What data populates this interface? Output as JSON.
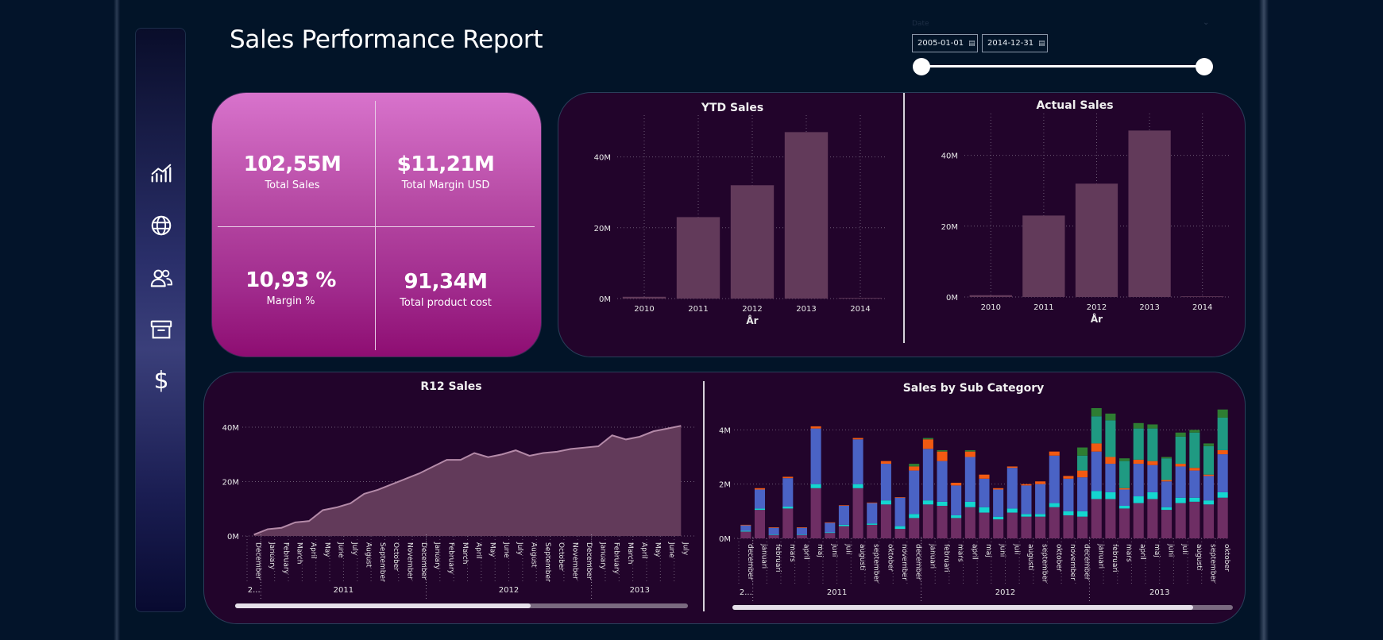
{
  "report": {
    "title": "Sales Performance Report"
  },
  "nav": {
    "items": [
      {
        "name": "nav-performance",
        "icon": "line-chart-icon"
      },
      {
        "name": "nav-geography",
        "icon": "globe-icon"
      },
      {
        "name": "nav-customers",
        "icon": "people-icon"
      },
      {
        "name": "nav-products",
        "icon": "archive-box-icon"
      },
      {
        "name": "nav-finance",
        "icon": "dollar-icon",
        "glyph": "$"
      }
    ]
  },
  "date_filter": {
    "label": "Date",
    "start": "2005-01-01",
    "end": "2014-12-31"
  },
  "kpis": {
    "total_sales": {
      "value": "102,55M",
      "label": "Total Sales"
    },
    "total_margin": {
      "value": "$11,21M",
      "label": "Total Margin USD"
    },
    "margin_pct": {
      "value": "10,93 %",
      "label": "Margin %"
    },
    "product_cost": {
      "value": "91,34M",
      "label": "Total product cost"
    }
  },
  "colors": {
    "bar": "#623a5a",
    "area": "#623a5a",
    "area_line": "#b48aa8",
    "panel_bg": "#22042b",
    "sub_purple": "#6e2e64",
    "sub_blue": "#4a63c5",
    "sub_cyan": "#14d6d0",
    "sub_teal": "#1f9a82",
    "sub_orange": "#f25a12",
    "sub_green": "#2e7d32"
  },
  "chart_data": [
    {
      "id": "ytd",
      "type": "bar",
      "title": "YTD Sales",
      "xlabel": "År",
      "ylabel": "",
      "categories": [
        "2010",
        "2011",
        "2012",
        "2013",
        "2014"
      ],
      "values": [
        0.5,
        23,
        32,
        47,
        0
      ],
      "yticks": [
        "0M",
        "20M",
        "40M"
      ],
      "ylim": [
        0,
        50
      ],
      "grid": true
    },
    {
      "id": "actual",
      "type": "bar",
      "title": "Actual Sales",
      "xlabel": "År",
      "ylabel": "",
      "categories": [
        "2010",
        "2011",
        "2012",
        "2013",
        "2014"
      ],
      "values": [
        0.5,
        23,
        32,
        47,
        0
      ],
      "yticks": [
        "0M",
        "20M",
        "40M"
      ],
      "ylim": [
        0,
        50
      ],
      "grid": true
    },
    {
      "id": "r12",
      "type": "area",
      "title": "R12 Sales",
      "months": [
        "December",
        "January",
        "February",
        "March",
        "April",
        "May",
        "June",
        "July",
        "August",
        "September",
        "October",
        "November",
        "December",
        "January",
        "February",
        "March",
        "April",
        "May",
        "June",
        "July",
        "August",
        "September",
        "October",
        "November",
        "December",
        "January",
        "February",
        "March",
        "April",
        "May",
        "June",
        "July"
      ],
      "values": [
        0.5,
        2.5,
        3,
        5,
        5.5,
        9.5,
        10.5,
        12,
        15.5,
        17,
        19,
        21,
        23,
        25.5,
        28,
        28,
        30.5,
        29,
        30,
        31.5,
        29.5,
        30.5,
        31,
        32,
        32.5,
        33,
        37,
        35.5,
        36.5,
        38.5,
        39.5,
        40.5
      ],
      "years": [
        "2...",
        "2011",
        "2012",
        "2013"
      ],
      "year_month_counts": [
        1,
        12,
        12,
        7
      ],
      "yticks": [
        "0M",
        "20M",
        "40M"
      ],
      "ylim": [
        0,
        40
      ],
      "grid": true
    },
    {
      "id": "subcat",
      "type": "bar",
      "title": "Sales by Sub Category",
      "months": [
        "december",
        "januari",
        "februari",
        "mars",
        "april",
        "maj",
        "juni",
        "juli",
        "augusti",
        "september",
        "oktober",
        "november",
        "december",
        "januari",
        "februari",
        "mars",
        "april",
        "maj",
        "juni",
        "juli",
        "augusti",
        "september",
        "oktober",
        "november",
        "december",
        "januari",
        "februari",
        "mars",
        "april",
        "maj",
        "juni",
        "juli",
        "augusti",
        "september",
        "oktober"
      ],
      "years": [
        "2...",
        "2011",
        "2012",
        "2013"
      ],
      "year_month_counts": [
        1,
        12,
        12,
        10
      ],
      "yticks": [
        "0M",
        "2M",
        "4M"
      ],
      "ylim": [
        0,
        4.8
      ],
      "series": [
        {
          "color_key": "sub_purple",
          "values": [
            0.25,
            1.05,
            0.12,
            1.1,
            0.12,
            1.85,
            0.2,
            0.45,
            1.85,
            0.5,
            1.25,
            0.35,
            0.75,
            1.25,
            1.2,
            0.75,
            1.15,
            0.95,
            0.7,
            0.95,
            0.8,
            0.8,
            1.15,
            0.85,
            0.8,
            1.45,
            1.45,
            1.1,
            1.3,
            1.45,
            1.05,
            1.3,
            1.35,
            1.25,
            1.5
          ]
        },
        {
          "color_key": "sub_cyan",
          "values": [
            0.03,
            0.05,
            0.02,
            0.07,
            0.02,
            0.15,
            0.02,
            0.05,
            0.15,
            0.05,
            0.15,
            0.1,
            0.15,
            0.15,
            0.15,
            0.1,
            0.2,
            0.2,
            0.1,
            0.15,
            0.1,
            0.1,
            0.15,
            0.15,
            0.2,
            0.3,
            0.25,
            0.1,
            0.25,
            0.25,
            0.1,
            0.2,
            0.15,
            0.15,
            0.2
          ]
        },
        {
          "color_key": "sub_blue",
          "values": [
            0.2,
            0.7,
            0.25,
            1.05,
            0.25,
            2.05,
            0.35,
            0.7,
            1.65,
            0.75,
            1.35,
            1.05,
            1.6,
            1.9,
            1.5,
            1.1,
            1.65,
            1.05,
            1.0,
            1.5,
            1.05,
            1.1,
            1.75,
            1.2,
            1.25,
            1.45,
            1.05,
            0.6,
            1.2,
            1.0,
            0.95,
            1.15,
            1.0,
            0.9,
            1.4
          ]
        },
        {
          "color_key": "sub_orange",
          "values": [
            0.02,
            0.05,
            0.02,
            0.05,
            0.02,
            0.08,
            0.02,
            0.02,
            0.05,
            0.02,
            0.1,
            0.02,
            0.15,
            0.35,
            0.35,
            0.1,
            0.2,
            0.15,
            0.05,
            0.05,
            0.05,
            0.1,
            0.15,
            0.1,
            0.25,
            0.3,
            0.25,
            0.05,
            0.15,
            0.15,
            0.05,
            0.1,
            0.1,
            0.05,
            0.15
          ]
        },
        {
          "color_key": "sub_teal",
          "values": [
            0,
            0,
            0,
            0,
            0,
            0,
            0,
            0,
            0,
            0,
            0,
            0,
            0,
            0,
            0,
            0,
            0,
            0,
            0,
            0,
            0,
            0,
            0,
            0,
            0.55,
            1.0,
            1.35,
            1.0,
            1.15,
            1.2,
            0.8,
            1.0,
            1.3,
            1.05,
            1.2
          ]
        },
        {
          "color_key": "sub_green",
          "values": [
            0,
            0,
            0,
            0,
            0,
            0,
            0,
            0,
            0,
            0,
            0,
            0,
            0.1,
            0.05,
            0.05,
            0,
            0.05,
            0,
            0,
            0,
            0,
            0,
            0,
            0,
            0.3,
            0.3,
            0.25,
            0.1,
            0.2,
            0.15,
            0.05,
            0.15,
            0.1,
            0.1,
            0.3
          ]
        }
      ],
      "grid": true
    }
  ]
}
